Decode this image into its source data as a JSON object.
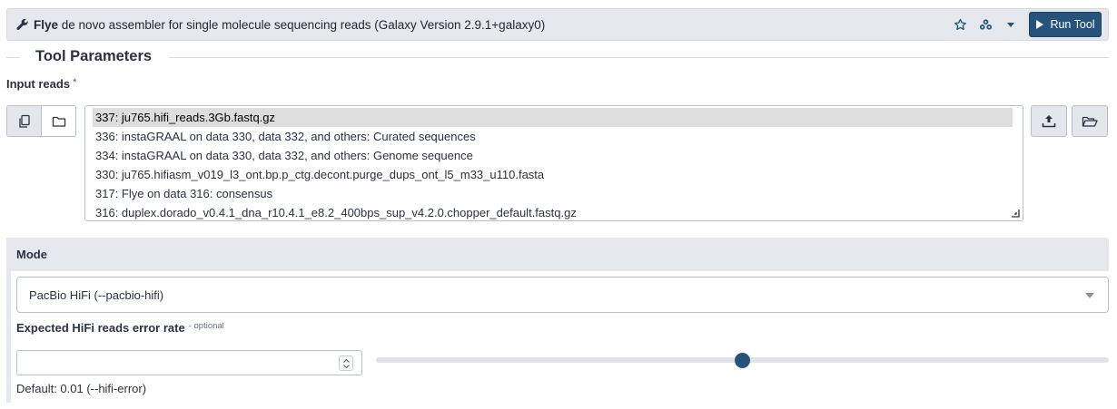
{
  "header": {
    "tool_name": "Flye",
    "tool_description": "de novo assembler for single molecule sequencing reads (Galaxy Version 2.9.1+galaxy0)",
    "run_label": "Run Tool",
    "icons": [
      "wrench-icon",
      "star-icon",
      "sitemap-icon",
      "caret-down-icon",
      "play-icon"
    ]
  },
  "section": {
    "title": "Tool Parameters"
  },
  "input_reads": {
    "label": "Input reads",
    "required_marker": "*",
    "options": [
      "337: ju765.hifi_reads.3Gb.fastq.gz",
      "336: instaGRAAL on data 330, data 332, and others: Curated sequences",
      "334: instaGRAAL on data 330, data 332, and others: Genome sequence",
      "330: ju765.hifiasm_v019_l3_ont.bp.p_ctg.decont.purge_dups_ont_l5_m33_u110.fasta",
      "317: Flye on data 316: consensus",
      "316: duplex.dorado_v0.4.1_dna_r10.4.1_e8.2_400bps_sup_v4.2.0.chopper_default.fastq.gz"
    ],
    "selected_index": 0
  },
  "mode": {
    "label": "Mode",
    "selected": "PacBio HiFi (--pacbio-hifi)"
  },
  "hifi_error": {
    "label": "Expected HiFi reads error rate",
    "optional_tag": "- optional",
    "value": "",
    "slider_fraction": 0.5,
    "help": "Default: 0.01 (--hifi-error)"
  }
}
